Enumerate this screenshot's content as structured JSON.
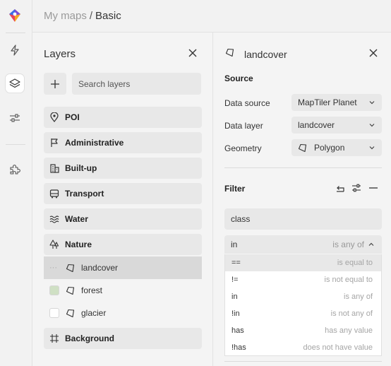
{
  "breadcrumb": {
    "parent": "My maps",
    "separator": "/",
    "current": "Basic"
  },
  "rail": {
    "items": [
      {
        "name": "lightning-icon",
        "active": false
      },
      {
        "name": "layers-icon",
        "active": true
      },
      {
        "name": "sliders-icon",
        "active": false
      },
      {
        "name": "puzzle-icon",
        "active": false
      }
    ]
  },
  "layers": {
    "title": "Layers",
    "search_placeholder": "Search layers",
    "groups": {
      "poi": "POI",
      "administrative": "Administrative",
      "builtup": "Built-up",
      "transport": "Transport",
      "water": "Water",
      "nature": "Nature",
      "background": "Background"
    },
    "children": [
      {
        "label": "landcover",
        "selected": true,
        "swatch": ""
      },
      {
        "label": "forest",
        "selected": false,
        "swatch": "#cfe0c4"
      },
      {
        "label": "glacier",
        "selected": false,
        "swatch": "#ffffff"
      }
    ]
  },
  "detail": {
    "title": "landcover",
    "source_heading": "Source",
    "fields": {
      "data_source_label": "Data source",
      "data_source_value": "MapTiler Planet",
      "data_layer_label": "Data layer",
      "data_layer_value": "landcover",
      "geometry_label": "Geometry",
      "geometry_value": "Polygon"
    },
    "filter_heading": "Filter",
    "filter_field": "class",
    "operator": {
      "symbol": "in",
      "description": "is any of"
    },
    "operator_options": [
      {
        "symbol": "==",
        "description": "is equal to",
        "highlighted": true
      },
      {
        "symbol": "!=",
        "description": "is not equal to",
        "highlighted": false
      },
      {
        "symbol": "in",
        "description": "is any of",
        "highlighted": false
      },
      {
        "symbol": "!in",
        "description": "is not any of",
        "highlighted": false
      },
      {
        "symbol": "has",
        "description": "has any value",
        "highlighted": false
      },
      {
        "symbol": "!has",
        "description": "does not have value",
        "highlighted": false
      }
    ]
  },
  "colors": {
    "logo_red": "#e8435a",
    "logo_orange": "#f6a623",
    "logo_purple": "#7b4dd6",
    "panel_bg": "#f4f4f4",
    "control_bg": "#e8e8e8",
    "selected_row": "#d9d9d9"
  }
}
